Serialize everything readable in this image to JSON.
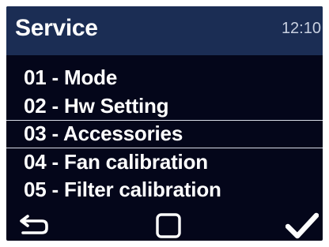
{
  "header": {
    "title": "Service",
    "time": "12:10"
  },
  "menu": {
    "items": [
      {
        "label": "01 - Mode"
      },
      {
        "label": "02 - Hw Setting"
      },
      {
        "label": "03 - Accessories",
        "selected": true
      },
      {
        "label": "04 - Fan calibration"
      },
      {
        "label": "05 - Filter calibration"
      }
    ]
  },
  "footer": {
    "back_icon": "back-arrow-icon",
    "home_icon": "square-icon",
    "ok_icon": "checkmark-icon"
  },
  "colors": {
    "background": "#04061a",
    "header": "#1b2d54",
    "text": "#ffffff"
  }
}
